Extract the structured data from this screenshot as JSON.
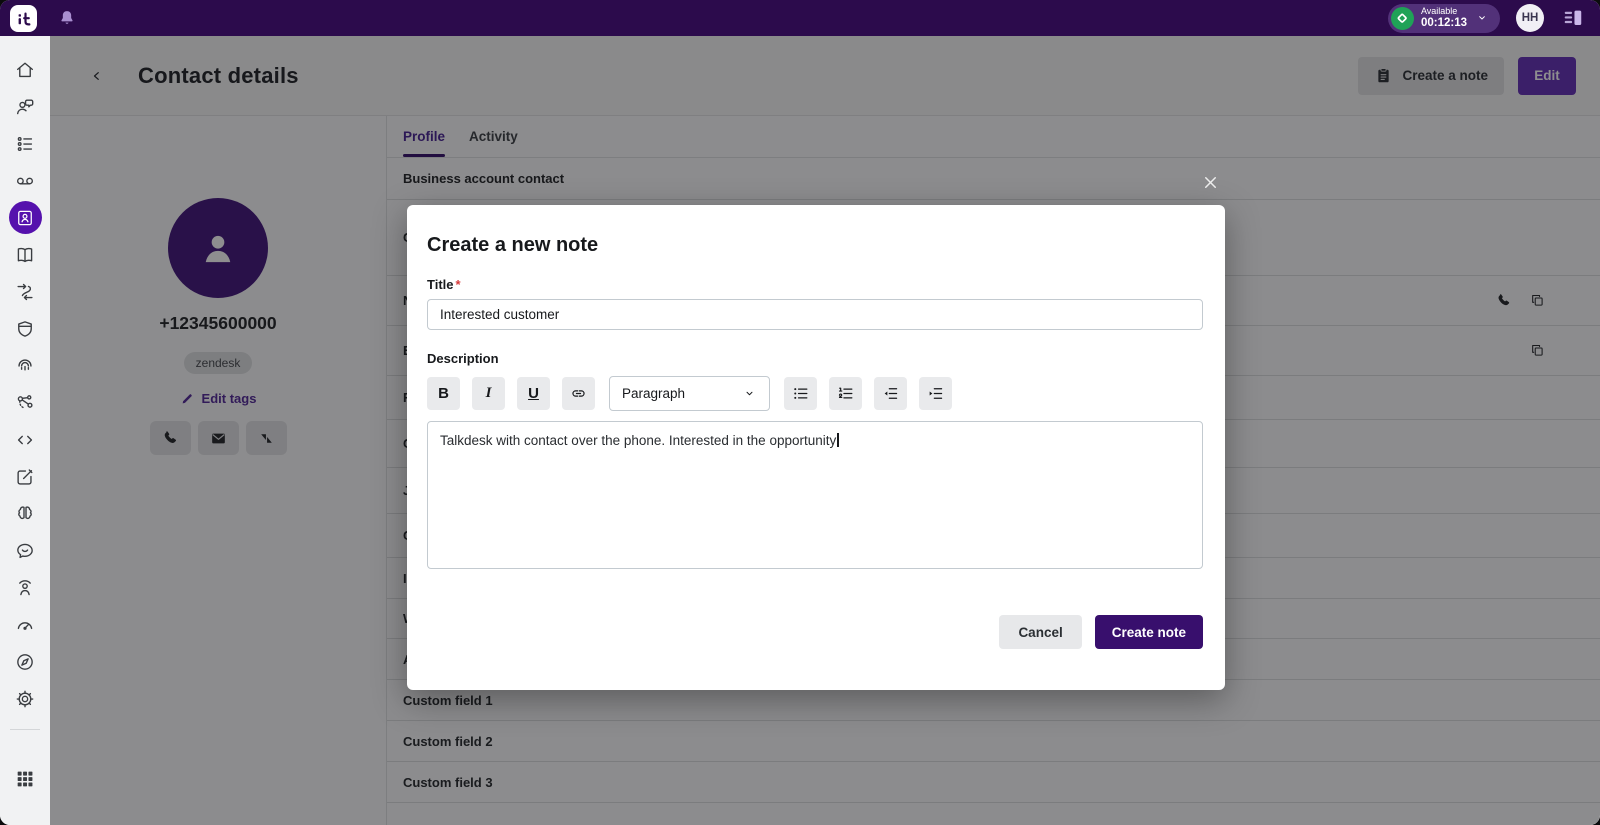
{
  "colors": {
    "brand_bar": "#2c0b4c",
    "accent_purple": "#552c9b",
    "active_icon_bg": "#5511ad",
    "edit_button": "#6733b9",
    "submit_button": "#380f6d",
    "status_green": "#1fa257",
    "required_red": "#d63a3a"
  },
  "topbar": {
    "status_label": "Available",
    "status_timer": "00:12:13",
    "avatar_initials": "HH",
    "icons": [
      "talkdesk-logo",
      "notifications-bell",
      "status-available-diamond",
      "chevron-down",
      "conversations-panel"
    ]
  },
  "sidebar": {
    "active_item": "contacts",
    "icons": [
      "home",
      "conversations",
      "tasks",
      "voicemail",
      "contacts",
      "library",
      "routing",
      "security",
      "voice-biometrics",
      "integrations",
      "code",
      "forms",
      "ai-assist",
      "feedback",
      "workforce",
      "dashboard",
      "explore",
      "settings",
      "apps-grid"
    ]
  },
  "header": {
    "back_icon": "chevron-left",
    "title": "Contact details",
    "create_note_button": "Create a note",
    "edit_button": "Edit"
  },
  "contact": {
    "phone_number": "+12345600000",
    "tag": "zendesk",
    "edit_tags_label": "Edit tags",
    "action_icons": [
      "phone",
      "email",
      "zendesk"
    ]
  },
  "tabs": {
    "profile": "Profile",
    "activity": "Activity"
  },
  "profile": {
    "section_header": "Business account contact",
    "rows": [
      {
        "label": "C",
        "icons": []
      },
      {
        "label": "N",
        "icons": [
          "phone",
          "copy"
        ]
      },
      {
        "label": "E",
        "icons": [
          "copy"
        ]
      },
      {
        "label": "F",
        "icons": []
      },
      {
        "label": "C",
        "icons": []
      },
      {
        "label": "J",
        "icons": []
      },
      {
        "label": "C",
        "icons": []
      },
      {
        "label": "I",
        "icons": []
      },
      {
        "label": "W",
        "icons": []
      },
      {
        "label": "A",
        "icons": []
      },
      {
        "label": "Custom field 1",
        "icons": []
      },
      {
        "label": "Custom field 2",
        "icons": []
      },
      {
        "label": "Custom field 3",
        "icons": []
      }
    ]
  },
  "modal": {
    "title": "Create a new note",
    "close_icon": "x-close",
    "title_field": {
      "label": "Title",
      "required_mark": "*",
      "value": "Interested customer"
    },
    "description_field": {
      "label": "Description",
      "value": "Talkdesk with contact over the phone. Interested in the opportunity"
    },
    "toolbar": {
      "bold": "B",
      "italic": "I",
      "underline": "U",
      "format_selected": "Paragraph",
      "icons": [
        "link",
        "bullet-list",
        "numbered-list",
        "outdent",
        "indent"
      ]
    },
    "cancel_button": "Cancel",
    "submit_button": "Create note"
  }
}
